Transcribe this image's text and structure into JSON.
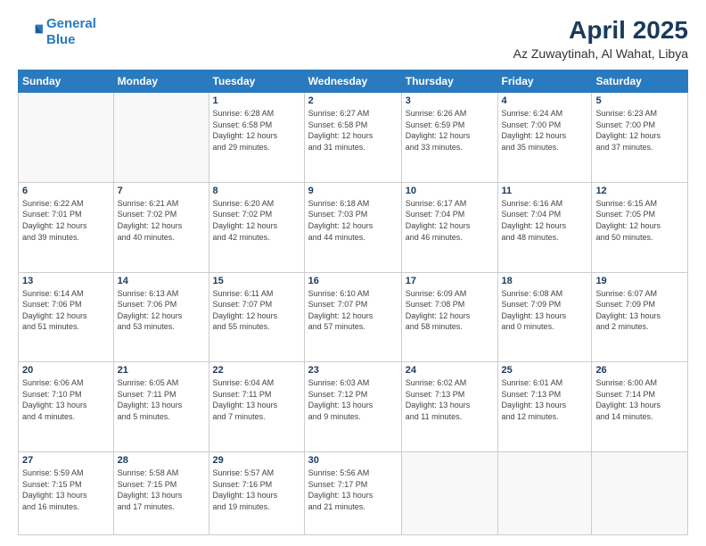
{
  "logo": {
    "line1": "General",
    "line2": "Blue"
  },
  "title": "April 2025",
  "subtitle": "Az Zuwaytinah, Al Wahat, Libya",
  "headers": [
    "Sunday",
    "Monday",
    "Tuesday",
    "Wednesday",
    "Thursday",
    "Friday",
    "Saturday"
  ],
  "weeks": [
    [
      {
        "day": "",
        "info": ""
      },
      {
        "day": "",
        "info": ""
      },
      {
        "day": "1",
        "info": "Sunrise: 6:28 AM\nSunset: 6:58 PM\nDaylight: 12 hours\nand 29 minutes."
      },
      {
        "day": "2",
        "info": "Sunrise: 6:27 AM\nSunset: 6:58 PM\nDaylight: 12 hours\nand 31 minutes."
      },
      {
        "day": "3",
        "info": "Sunrise: 6:26 AM\nSunset: 6:59 PM\nDaylight: 12 hours\nand 33 minutes."
      },
      {
        "day": "4",
        "info": "Sunrise: 6:24 AM\nSunset: 7:00 PM\nDaylight: 12 hours\nand 35 minutes."
      },
      {
        "day": "5",
        "info": "Sunrise: 6:23 AM\nSunset: 7:00 PM\nDaylight: 12 hours\nand 37 minutes."
      }
    ],
    [
      {
        "day": "6",
        "info": "Sunrise: 6:22 AM\nSunset: 7:01 PM\nDaylight: 12 hours\nand 39 minutes."
      },
      {
        "day": "7",
        "info": "Sunrise: 6:21 AM\nSunset: 7:02 PM\nDaylight: 12 hours\nand 40 minutes."
      },
      {
        "day": "8",
        "info": "Sunrise: 6:20 AM\nSunset: 7:02 PM\nDaylight: 12 hours\nand 42 minutes."
      },
      {
        "day": "9",
        "info": "Sunrise: 6:18 AM\nSunset: 7:03 PM\nDaylight: 12 hours\nand 44 minutes."
      },
      {
        "day": "10",
        "info": "Sunrise: 6:17 AM\nSunset: 7:04 PM\nDaylight: 12 hours\nand 46 minutes."
      },
      {
        "day": "11",
        "info": "Sunrise: 6:16 AM\nSunset: 7:04 PM\nDaylight: 12 hours\nand 48 minutes."
      },
      {
        "day": "12",
        "info": "Sunrise: 6:15 AM\nSunset: 7:05 PM\nDaylight: 12 hours\nand 50 minutes."
      }
    ],
    [
      {
        "day": "13",
        "info": "Sunrise: 6:14 AM\nSunset: 7:06 PM\nDaylight: 12 hours\nand 51 minutes."
      },
      {
        "day": "14",
        "info": "Sunrise: 6:13 AM\nSunset: 7:06 PM\nDaylight: 12 hours\nand 53 minutes."
      },
      {
        "day": "15",
        "info": "Sunrise: 6:11 AM\nSunset: 7:07 PM\nDaylight: 12 hours\nand 55 minutes."
      },
      {
        "day": "16",
        "info": "Sunrise: 6:10 AM\nSunset: 7:07 PM\nDaylight: 12 hours\nand 57 minutes."
      },
      {
        "day": "17",
        "info": "Sunrise: 6:09 AM\nSunset: 7:08 PM\nDaylight: 12 hours\nand 58 minutes."
      },
      {
        "day": "18",
        "info": "Sunrise: 6:08 AM\nSunset: 7:09 PM\nDaylight: 13 hours\nand 0 minutes."
      },
      {
        "day": "19",
        "info": "Sunrise: 6:07 AM\nSunset: 7:09 PM\nDaylight: 13 hours\nand 2 minutes."
      }
    ],
    [
      {
        "day": "20",
        "info": "Sunrise: 6:06 AM\nSunset: 7:10 PM\nDaylight: 13 hours\nand 4 minutes."
      },
      {
        "day": "21",
        "info": "Sunrise: 6:05 AM\nSunset: 7:11 PM\nDaylight: 13 hours\nand 5 minutes."
      },
      {
        "day": "22",
        "info": "Sunrise: 6:04 AM\nSunset: 7:11 PM\nDaylight: 13 hours\nand 7 minutes."
      },
      {
        "day": "23",
        "info": "Sunrise: 6:03 AM\nSunset: 7:12 PM\nDaylight: 13 hours\nand 9 minutes."
      },
      {
        "day": "24",
        "info": "Sunrise: 6:02 AM\nSunset: 7:13 PM\nDaylight: 13 hours\nand 11 minutes."
      },
      {
        "day": "25",
        "info": "Sunrise: 6:01 AM\nSunset: 7:13 PM\nDaylight: 13 hours\nand 12 minutes."
      },
      {
        "day": "26",
        "info": "Sunrise: 6:00 AM\nSunset: 7:14 PM\nDaylight: 13 hours\nand 14 minutes."
      }
    ],
    [
      {
        "day": "27",
        "info": "Sunrise: 5:59 AM\nSunset: 7:15 PM\nDaylight: 13 hours\nand 16 minutes."
      },
      {
        "day": "28",
        "info": "Sunrise: 5:58 AM\nSunset: 7:15 PM\nDaylight: 13 hours\nand 17 minutes."
      },
      {
        "day": "29",
        "info": "Sunrise: 5:57 AM\nSunset: 7:16 PM\nDaylight: 13 hours\nand 19 minutes."
      },
      {
        "day": "30",
        "info": "Sunrise: 5:56 AM\nSunset: 7:17 PM\nDaylight: 13 hours\nand 21 minutes."
      },
      {
        "day": "",
        "info": ""
      },
      {
        "day": "",
        "info": ""
      },
      {
        "day": "",
        "info": ""
      }
    ]
  ]
}
